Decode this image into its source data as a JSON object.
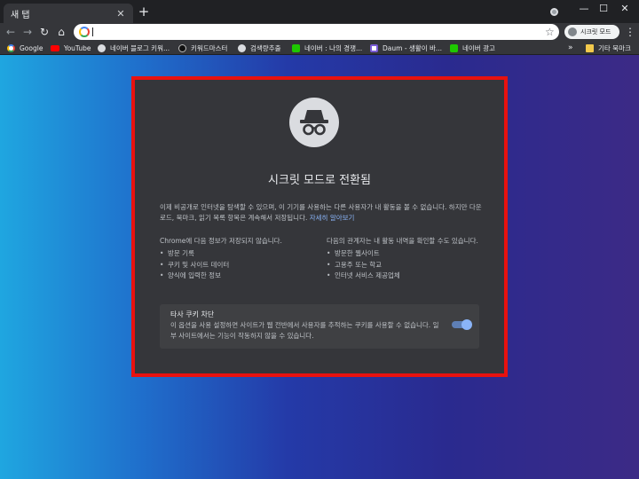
{
  "tab": {
    "title": "새 탭",
    "close_glyph": "✕",
    "new_tab_glyph": "+"
  },
  "window": {
    "minimize": "—",
    "maximize": "☐",
    "close": "✕"
  },
  "toolbar": {
    "back": "←",
    "forward": "→",
    "reload": "↻",
    "home": "⌂",
    "address_value": "",
    "bookmark_star": "☆",
    "incognito_label": "시크릿 모드",
    "menu": "⋮"
  },
  "bookmarks": {
    "items": [
      {
        "label": "Google",
        "icon": "google-icon",
        "color": "#ffffff"
      },
      {
        "label": "YouTube",
        "icon": "youtube-icon",
        "color": "#ff0000"
      },
      {
        "label": "네이버 블로그 키워...",
        "icon": "globe-icon",
        "color": "#dadce0"
      },
      {
        "label": "키워드마스터",
        "icon": "k-icon",
        "color": "#111111"
      },
      {
        "label": "검색량추출",
        "icon": "globe-icon",
        "color": "#dadce0"
      },
      {
        "label": "네이버 : 나의 경쟁...",
        "icon": "naver-icon",
        "color": "#1ec800"
      },
      {
        "label": "Daum - 생활이 바...",
        "icon": "daum-icon",
        "color": "#ffffff"
      },
      {
        "label": "네이버 광고",
        "icon": "naver-icon",
        "color": "#1ec800"
      }
    ],
    "more": "»",
    "other_folder": "기타 북마크"
  },
  "incognito": {
    "heading": "시크릿 모드로 전환됨",
    "intro": "이제 비공개로 인터넷을 탐색할 수 있으며, 이 기기를 사용하는 다른 사용자가 내 활동을 볼 수 없습니다. 하지만 다운로드, 북마크, 읽기 목록 항목은 계속해서 저장됩니다.",
    "learn_more": "자세히 알아보기",
    "not_saved_title": "Chrome에 다음 정보가 저장되지 않습니다.",
    "not_saved_items": [
      "방문 기록",
      "쿠키 및 사이트 데이터",
      "양식에 입력한 정보"
    ],
    "visible_title": "다음의 관계자는 내 활동 내역을 확인할 수도 있습니다.",
    "visible_items": [
      "방문한 웹사이트",
      "고용주 또는 학교",
      "인터넷 서비스 제공업체"
    ],
    "cookie_title": "타사 쿠키 차단",
    "cookie_desc": "이 옵션을 사용 설정하면 사이트가 웹 전반에서 사용자를 추적하는 쿠키를 사용할 수 없습니다. 일부 사이트에서는 기능이 작동하지 않을 수 있습니다.",
    "cookie_toggle_on": true
  },
  "colors": {
    "highlight_frame": "#e8120f",
    "panel_bg": "#35363a",
    "link": "#8ab4f8",
    "toggle": "#8ab4f8"
  }
}
